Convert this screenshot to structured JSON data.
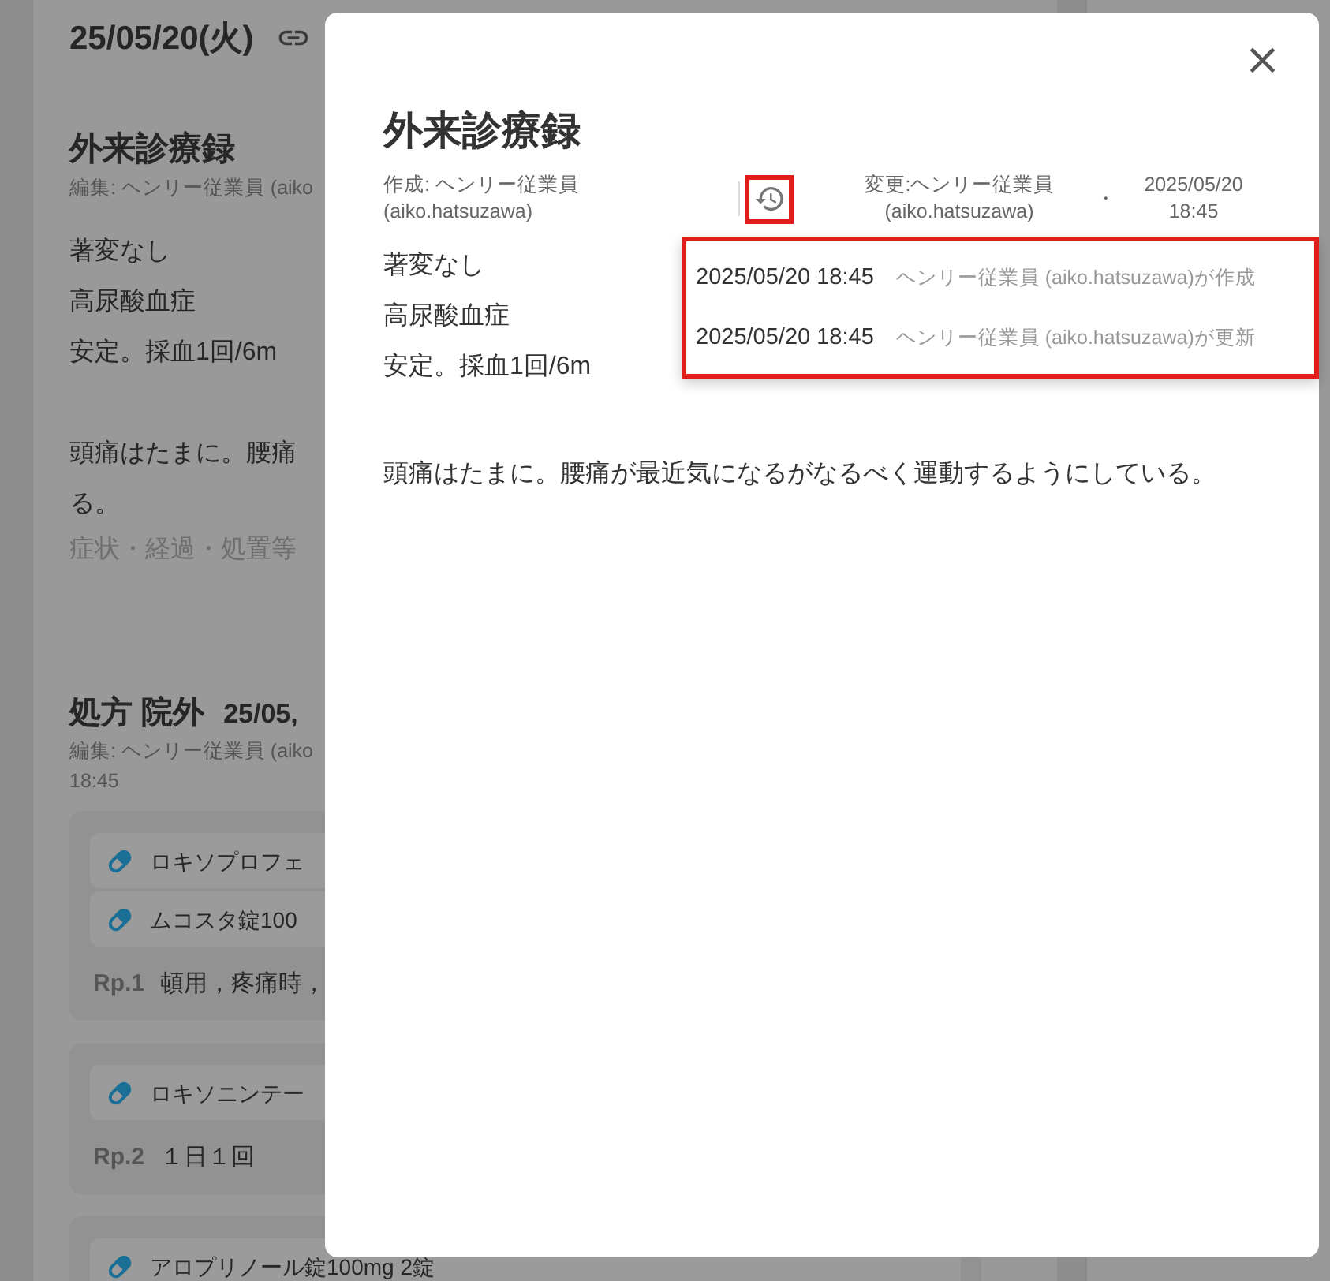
{
  "background_page": {
    "date_header": "25/05/20(火)",
    "record": {
      "title": "外来診療録",
      "edited": "編集: ヘンリー従業員 (aiko",
      "lines": [
        "著変なし",
        "高尿酸血症",
        "安定。採血1回/6m"
      ],
      "paragraph_lines": [
        "頭痛はたまに。腰痛",
        "る。"
      ],
      "placeholder": "症状・経過・処置等"
    },
    "prescription": {
      "title": "処方 院外",
      "date": "25/05,",
      "edited_lines": [
        "編集: ヘンリー従業員 (aiko",
        "18:45"
      ],
      "groups": [
        {
          "drugs": [
            "ロキソプロフェ",
            "ムコスタ錠100"
          ],
          "rp": "Rp.1",
          "usage": "頓用，疼痛時，"
        },
        {
          "drugs": [
            "ロキソニンテー"
          ],
          "rp": "Rp.2",
          "usage": "１日１回"
        },
        {
          "drugs": [
            "アロプリノール錠100mg  2錠"
          ]
        }
      ]
    }
  },
  "modal": {
    "close": "×",
    "title": "外来診療録",
    "created": "作成: ヘンリー従業員 (aiko.hatsuzawa)",
    "changed": "変更:ヘンリー従業員 (aiko.hatsuzawa)",
    "separator": "・",
    "changed_at": "2025/05/20 18:45",
    "history": [
      {
        "time": "2025/05/20 18:45",
        "text": "ヘンリー従業員 (aiko.hatsuzawa)が作成"
      },
      {
        "time": "2025/05/20 18:45",
        "text": "ヘンリー従業員 (aiko.hatsuzawa)が更新"
      }
    ],
    "lines": [
      "著変なし",
      "高尿酸血症",
      "安定。採血1回/6m"
    ],
    "paragraph": "頭痛はたまに。腰痛が最近気になるがなるべく運動するようにしている。"
  }
}
